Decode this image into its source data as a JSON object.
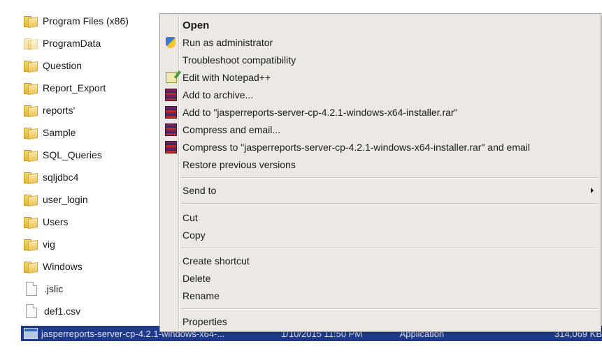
{
  "files": [
    {
      "name": "Program Files (x86)",
      "icon": "folder-icon"
    },
    {
      "name": "ProgramData",
      "icon": "folder-icon"
    },
    {
      "name": "Question",
      "icon": "folder-icon"
    },
    {
      "name": "Report_Export",
      "icon": "folder-icon"
    },
    {
      "name": "reports'",
      "icon": "folder-icon"
    },
    {
      "name": "Sample",
      "icon": "folder-icon"
    },
    {
      "name": "SQL_Queries",
      "icon": "folder-icon"
    },
    {
      "name": "sqljdbc4",
      "icon": "folder-icon"
    },
    {
      "name": "user_login",
      "icon": "folder-icon"
    },
    {
      "name": "Users",
      "icon": "folder-icon"
    },
    {
      "name": "vig",
      "icon": "folder-icon"
    },
    {
      "name": "Windows",
      "icon": "folder-icon"
    },
    {
      "name": ".jslic",
      "icon": "file-icon"
    },
    {
      "name": "def1.csv",
      "icon": "file-icon"
    }
  ],
  "selected_file": {
    "name": "jasperreports-server-cp-4.2.1-windows-x64-...",
    "date": "1/10/2015 11:50 PM",
    "type": "Application",
    "size": "314,069 KB",
    "icon": "application-icon"
  },
  "context_menu": {
    "items": [
      {
        "label": "Open",
        "bold": true
      },
      {
        "label": "Run as administrator",
        "icon": "shield-icon"
      },
      {
        "label": "Troubleshoot compatibility"
      },
      {
        "label": "Edit with Notepad++",
        "icon": "notepad-icon"
      },
      {
        "label": "Add to archive...",
        "icon": "rar-icon"
      },
      {
        "label": "Add to \"jasperreports-server-cp-4.2.1-windows-x64-installer.rar\"",
        "icon": "rar-icon"
      },
      {
        "label": "Compress and email...",
        "icon": "rar-icon"
      },
      {
        "label": "Compress to \"jasperreports-server-cp-4.2.1-windows-x64-installer.rar\" and email",
        "icon": "rar-icon"
      },
      {
        "label": "Restore previous versions"
      },
      {
        "label": "Send to",
        "submenu": true
      },
      {
        "label": "Cut"
      },
      {
        "label": "Copy"
      },
      {
        "label": "Create shortcut"
      },
      {
        "label": "Delete"
      },
      {
        "label": "Rename"
      },
      {
        "label": "Properties"
      }
    ]
  },
  "colors": {
    "menu_background": "#ece9e4",
    "selection": "#1f3a8a"
  }
}
